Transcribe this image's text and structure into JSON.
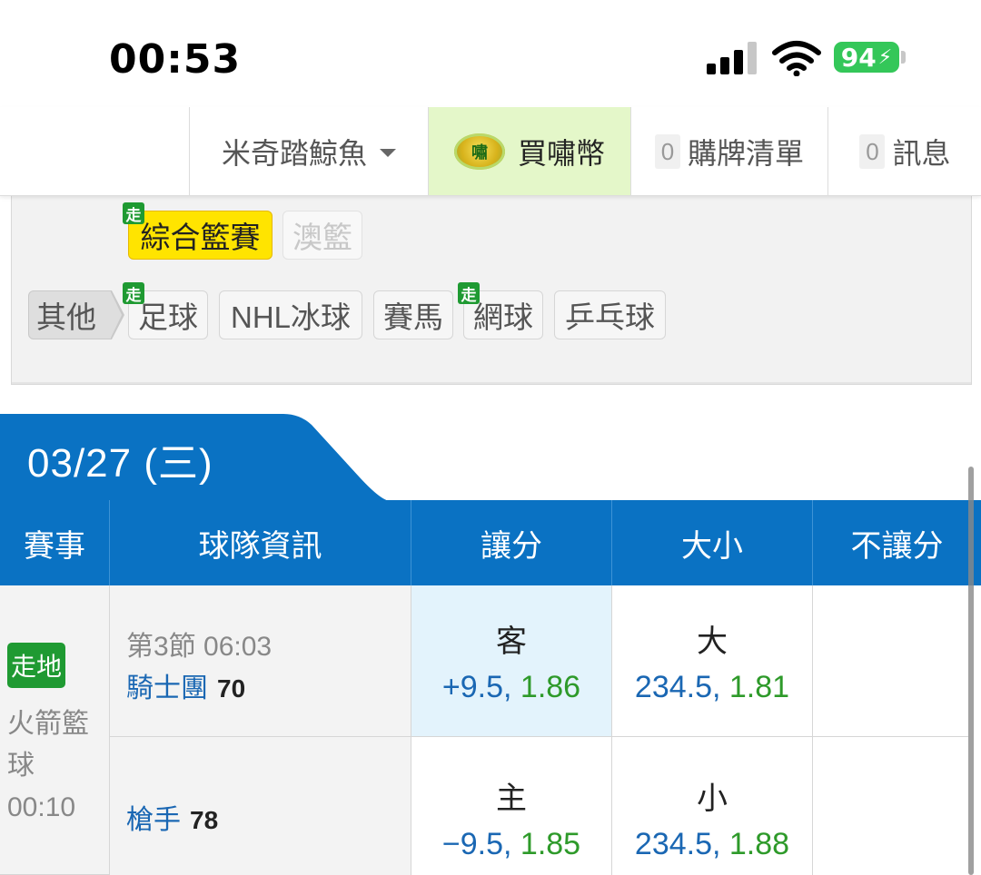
{
  "status_bar": {
    "time": "00:53",
    "battery": "94"
  },
  "nav": {
    "username": "米奇踏鯨魚",
    "coin_icon_text": "嘯",
    "coin_label": "買嘯幣",
    "cart_count": "0",
    "cart_label": "購牌清單",
    "msg_count": "0",
    "msg_label": "訊息"
  },
  "sports": {
    "live_badge": "走",
    "row1": [
      {
        "label": "綜合籃賽",
        "state": "active",
        "live": true
      },
      {
        "label": "澳籃",
        "state": "disabled",
        "live": false
      }
    ],
    "other_label": "其他",
    "row2": [
      {
        "label": "足球",
        "live": true
      },
      {
        "label": "NHL冰球",
        "live": false
      },
      {
        "label": "賽馬",
        "live": false
      },
      {
        "label": "網球",
        "live": true
      },
      {
        "label": "乒乓球",
        "live": false
      }
    ]
  },
  "date_tab": "03/27 (三)",
  "table": {
    "headers": [
      "賽事",
      "球隊資訊",
      "讓分",
      "大小",
      "不讓分"
    ],
    "event": {
      "live_tag": "走地",
      "league": "火箭籃球",
      "time": "00:10"
    },
    "period": "第3節 06:03",
    "rows": [
      {
        "team": "騎士團",
        "score": "70",
        "spread": {
          "side": "客",
          "line": "+9.5,",
          "price": "1.86"
        },
        "total": {
          "side": "大",
          "line": "234.5,",
          "price": "1.81"
        }
      },
      {
        "team": "槍手",
        "score": "78",
        "spread": {
          "side": "主",
          "line": "−9.5,",
          "price": "1.85"
        },
        "total": {
          "side": "小",
          "line": "234.5,",
          "price": "1.88"
        }
      }
    ]
  },
  "colors": {
    "header_blue": "#0a72c3",
    "active_chip": "#ffe400",
    "live_green": "#1f9a32",
    "odds_price": "#2e9a2a"
  }
}
